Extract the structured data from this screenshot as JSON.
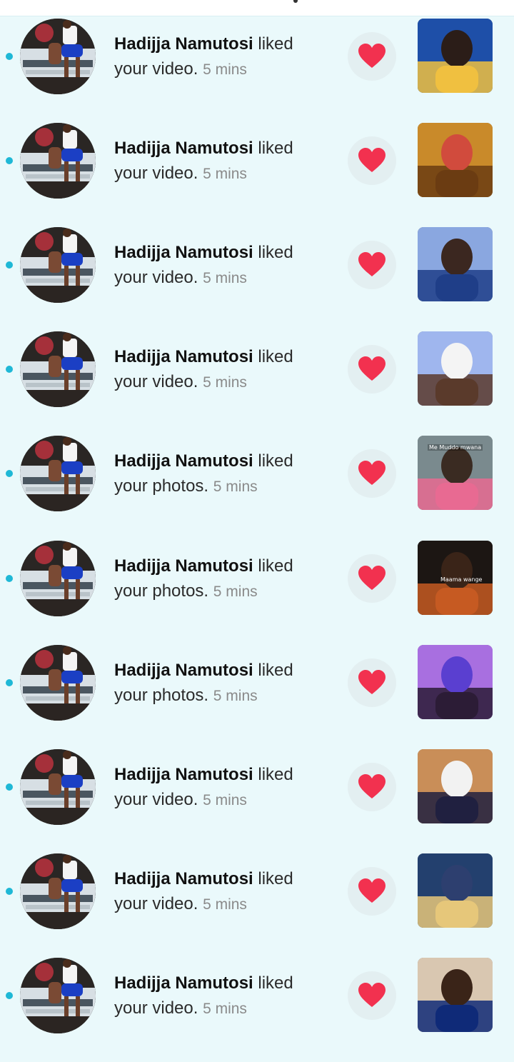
{
  "notifications": [
    {
      "name": "Hadijja Namutosi",
      "action": "liked your video.",
      "time": "5 mins",
      "thumb_colors": [
        "#1e4fa8",
        "#f0c040",
        "#2b1d18"
      ]
    },
    {
      "name": "Hadijja Namutosi",
      "action": "liked your video.",
      "time": "5 mins",
      "thumb_colors": [
        "#c98a2a",
        "#6b3c12",
        "#d14b3d"
      ]
    },
    {
      "name": "Hadijja Namutosi",
      "action": "liked your video.",
      "time": "5 mins",
      "thumb_colors": [
        "#8aa7e0",
        "#1f3e88",
        "#3b2720"
      ]
    },
    {
      "name": "Hadijja Namutosi",
      "action": "liked your video.",
      "time": "5 mins",
      "thumb_colors": [
        "#9fb6ee",
        "#5a3a2b",
        "#f4f4f4"
      ]
    },
    {
      "name": "Hadijja Namutosi",
      "action": "liked your photos.",
      "time": "5 mins",
      "thumb_colors": [
        "#7a8a8e",
        "#e86a92",
        "#3a2b22"
      ],
      "caption": "Me Muddo mwana"
    },
    {
      "name": "Hadijja Namutosi",
      "action": "liked your photos.",
      "time": "5 mins",
      "thumb_colors": [
        "#1c1613",
        "#c65a22",
        "#3a2418"
      ],
      "caption": "Maama wange"
    },
    {
      "name": "Hadijja Namutosi",
      "action": "liked your photos.",
      "time": "5 mins",
      "thumb_colors": [
        "#a86fe0",
        "#2c1c36",
        "#5a3fd0"
      ]
    },
    {
      "name": "Hadijja Namutosi",
      "action": "liked your video.",
      "time": "5 mins",
      "thumb_colors": [
        "#c98e58",
        "#202040",
        "#f2f2f2"
      ]
    },
    {
      "name": "Hadijja Namutosi",
      "action": "liked your video.",
      "time": "5 mins",
      "thumb_colors": [
        "#23406e",
        "#e6c77a",
        "#2d3f6f"
      ]
    },
    {
      "name": "Hadijja Namutosi",
      "action": "liked your video.",
      "time": "5 mins",
      "thumb_colors": [
        "#d9c7b1",
        "#0f2a78",
        "#3a2418"
      ]
    }
  ],
  "icons": {
    "heart": "heart-icon",
    "unread": "unread-dot"
  },
  "colors": {
    "background": "#eaf9fb",
    "unread_dot": "#1fb8d6",
    "heart": "#f2314f",
    "heart_button_bg": "#e3eff1"
  }
}
